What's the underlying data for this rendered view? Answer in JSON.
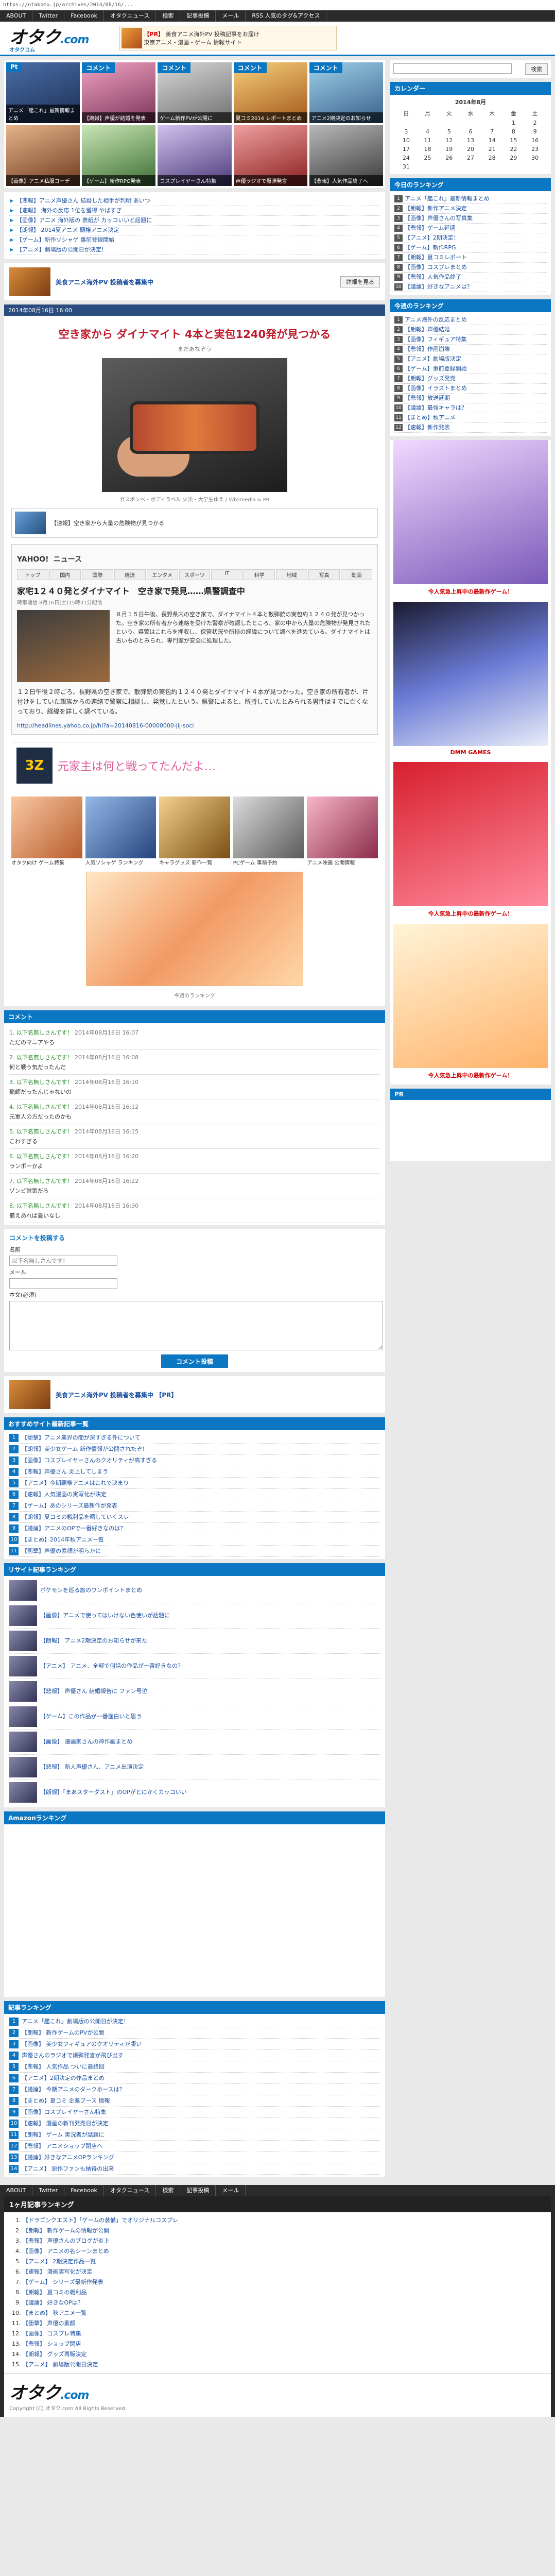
{
  "url": "https://otakomu.jp/archives/2014/08/16/...",
  "nav": [
    "ABOUT",
    "Twitter",
    "Facebook",
    "オタクニュース",
    "検索",
    "記事投稿",
    "メール",
    "RSS 人気のタグ&アクセス"
  ],
  "logo": {
    "name": "オタク",
    "dot": ".com",
    "sub": "オタクコム"
  },
  "header_banner": {
    "label": "【PR】",
    "text": "美食アニメ海外PV 投稿記事をお届け",
    "sub": "東京アニメ・漫画・ゲーム 情報サイト"
  },
  "tiles": [
    {
      "num": "Pt",
      "cap": "アニメ「艦これ」最新情報まとめ"
    },
    {
      "num": "コメント",
      "cap": "【朗報】声優が結婚を発表"
    },
    {
      "num": "コメント",
      "cap": "ゲーム新作PVが公開に"
    },
    {
      "num": "コメント",
      "cap": "夏コミ2014 レポートまとめ"
    },
    {
      "num": "コメント",
      "cap": "アニメ2期決定のお知らせ"
    },
    {
      "num": "",
      "cap": "【画像】アニメ私服コーデ"
    },
    {
      "num": "",
      "cap": "【ゲーム】新作RPG発表"
    },
    {
      "num": "",
      "cap": "コスプレイヤーさん特集"
    },
    {
      "num": "",
      "cap": "声優ラジオで爆弾発言"
    },
    {
      "num": "",
      "cap": "【悲報】人気作品終了へ"
    }
  ],
  "top_links": [
    "【悲報】アニメ声優さん 結婚した相手が判明 あいつ",
    "【速報】 海外の反応 1位を獲得 やばすぎ",
    "【画像】アニメ 海外版の 表紙が カッコいいと話題に",
    "【朗報】 2014夏アニメ 覇権アニメ決定",
    "【ゲーム】新作ソシャゲ 事前登録開始",
    "【アニメ】劇場版の公開日が決定！"
  ],
  "promo": {
    "text": "美食アニメ海外PV 投稿者を募集中",
    "button": "詳細を見る"
  },
  "article": {
    "meta": "2014年08月16日 16:00",
    "title": "空き家から ダイナマイト 4本と実包1240発が見つかる",
    "byline": "まだあなぞう",
    "image_caption": "ガスボンベ・ボディラベル 火災・大学生ゆえ / Wikimedia & PR",
    "related": "【速報】空き家から大量の危険物が見つかる",
    "quote": {
      "logo": "YAHOO!",
      "logo_sub": "ニュース",
      "nav": [
        "トップ",
        "国内",
        "国際",
        "経済",
        "エンタメ",
        "スポーツ",
        "IT",
        "科学",
        "地域",
        "写真",
        "動画"
      ],
      "title": "家宅1２４０発とダイナマイト　空き家で発見……県警調査中",
      "date": "時事通信 8月16日(土)15時31分配信",
      "text": "８月１５日午後、長野県内の空き家で、ダイナマイト４本と散弾銃の実包約１２４０発が見つかった。空き家の所有者から連絡を受けた警察が確認したところ、家の中から大量の危険物が発見されたという。県警はこれらを押収し、保管状況や所持の経緯について調べを進めている。ダイナマイトは古いものとみられ、専門家が安全に処理した。",
      "body": "１２日午後２時ごろ、長野県の空き家で、散弾銃の実包約１２４０発とダイナマイト４本が見つかった。空き家の所有者が、片付けをしていた親族からの連絡で警察に相談し、発覚したという。県警によると、所持していたとみられる男性はすでに亡くなっており、経緯を詳しく調べている。"
    },
    "source": "http://headlines.yahoo.co.jp/hl?a=20140816-00000000-jij-soci",
    "card": {
      "logo": "3Z",
      "text": "元家主は何と戦ってたんだよ…"
    },
    "ads": [
      {
        "cap": "オタク向け ゲーム特集"
      },
      {
        "cap": "人気ソシャゲ ランキング"
      },
      {
        "cap": "キャラグッズ 新作一覧"
      },
      {
        "cap": "PCゲーム 事前予約"
      },
      {
        "cap": "アニメ映画 公開情報"
      }
    ],
    "banner_cap": "今週のランキング"
  },
  "comments": {
    "title": "コメント",
    "items": [
      {
        "name": "1. 以下名無しさんです！",
        "date": "2014年08月16日 16:07",
        "body": "ただのマニアやろ"
      },
      {
        "name": "2. 以下名無しさんです！",
        "date": "2014年08月16日 16:08",
        "body": "何と戦う気だったんだ"
      },
      {
        "name": "3. 以下名無しさんです！",
        "date": "2014年08月16日 16:10",
        "body": "猟師だったんじゃないの"
      },
      {
        "name": "4. 以下名無しさんです！",
        "date": "2014年08月16日 16:12",
        "body": "元軍人の方だったのかも"
      },
      {
        "name": "5. 以下名無しさんです！",
        "date": "2014年08月16日 16:15",
        "body": "こわすぎる"
      },
      {
        "name": "6. 以下名無しさんです！",
        "date": "2014年08月16日 16:20",
        "body": "ランボーかよ"
      },
      {
        "name": "7. 以下名無しさんです！",
        "date": "2014年08月16日 16:22",
        "body": "ゾンビ対策だろ"
      },
      {
        "name": "8. 以下名無しさんです！",
        "date": "2014年08月16日 16:30",
        "body": "備えあれば憂いなし"
      }
    ]
  },
  "comment_form": {
    "title": "コメントを投稿する",
    "name_label": "名前",
    "name_placeholder": "以下名無しさんです！",
    "mail_label": "メール",
    "body_label": "本文(必須)",
    "submit": "コメント投稿"
  },
  "promo2": {
    "text": "美食アニメ海外PV 投稿者を募集中 【PR】"
  },
  "recommend": {
    "title": "おすすめサイト最新記事一覧",
    "items": [
      "【衝撃】アニメ業界の闇が深すぎる件について",
      "【朗報】美少女ゲーム 新作情報が公開されたぞ！",
      "【画像】コスプレイヤーさんのクオリティが高すぎる",
      "【悲報】声優さん 炎上してしまう",
      "【アニメ】今期覇権アニメはこれで決まり",
      "【速報】人気漫画の実写化が決定",
      "【ゲーム】あのシリーズ最新作が発表",
      "【朗報】夏コミの戦利品を晒していくスレ",
      "【議論】アニメのOPで一番好きなのは？",
      "【まとめ】2014年秋アニメ一覧",
      "【衝撃】声優の素顔が明らかに"
    ]
  },
  "ranking": {
    "title": "リサイト記事ランキング",
    "items": [
      "ポケモンを巡る旅のワンポイントまとめ",
      "【画像】アニメで使ってはいけない色使いが話題に",
      "【朗報】 アニメ2期決定のお知らせが来た",
      "【アニメ】 アニメ、全部で何話の作品が一番好きなの？",
      "【悲報】 声優さん 結婚報告に ファン号泣",
      "【ゲーム】この作品が一番面白いと思う",
      "【画像】 漫画家さんの神作画まとめ",
      "【悲報】 新人声優さん、アニメ出演決定",
      "【朗報】「まあスターダスト」のOPがとにかくカッコいい"
    ]
  },
  "amazon_title": "Amazonランキング",
  "recommend2": {
    "title": "記事ランキング",
    "items": [
      "アニメ「艦これ」劇場版の公開日が決定！",
      "【朗報】 新作ゲームのPVが公開",
      "【画像】 美少女フィギュアのクオリティが凄い",
      "声優さんのラジオで爆弾発言が飛び出す",
      "【悲報】 人気作品 ついに最終回",
      "【アニメ】2期決定の作品まとめ",
      "【議論】 今期アニメのダークホースは？",
      "【まとめ】夏コミ 企業ブース 情報",
      "【画像】コスプレイヤーさん特集",
      "【速報】 漫画の新刊発売日が決定",
      "【朗報】 ゲーム 実況者が話題に",
      "【悲報】 アニメショップ閉店へ",
      "【議論】好きなアニメOPランキング",
      "【アニメ】 原作ファンも納得の出来"
    ]
  },
  "side": {
    "search_placeholder": "",
    "search_button": "検索",
    "calendar_title": "カレンダー",
    "month": "2014年8月",
    "weekdays": [
      "日",
      "月",
      "火",
      "水",
      "木",
      "金",
      "土"
    ],
    "weeks": [
      [
        "",
        "",
        "",
        "",
        "",
        "1",
        "2"
      ],
      [
        "3",
        "4",
        "5",
        "6",
        "7",
        "8",
        "9"
      ],
      [
        "10",
        "11",
        "12",
        "13",
        "14",
        "15",
        "16"
      ],
      [
        "17",
        "18",
        "19",
        "20",
        "21",
        "22",
        "23"
      ],
      [
        "24",
        "25",
        "26",
        "27",
        "28",
        "29",
        "30"
      ],
      [
        "31",
        "",
        "",
        "",
        "",
        "",
        ""
      ]
    ],
    "ranking_title": "今日のランキング",
    "ranking": [
      "アニメ「艦これ」最新情報まとめ",
      "【朗報】新作アニメ決定",
      "【画像】声優さんの写真集",
      "【悲報】ゲーム延期",
      "【アニメ】2期決定！",
      "【ゲーム】新作RPG",
      "【朗報】夏コミレポート",
      "【画像】コスプレまとめ",
      "【悲報】人気作品終了",
      "【議論】好きなアニメは？"
    ],
    "ranking2_title": "今週のランキング",
    "ranking2": [
      "アニメ海外の反応まとめ",
      "【朗報】声優結婚",
      "【画像】フィギュア特集",
      "【悲報】作画崩壊",
      "【アニメ】劇場版決定",
      "【ゲーム】事前登録開始",
      "【朗報】グッズ発売",
      "【画像】イラストまとめ",
      "【悲報】放送延期",
      "【議論】最強キャラは？",
      "【まとめ】秋アニメ",
      "【速報】新作発表"
    ],
    "ad_captions": [
      "今人気急上昇中の最新作ゲーム！",
      "DMM GAMES",
      "今人気急上昇中の最新作ゲーム！",
      "今人気急上昇中の最新作ゲーム！"
    ],
    "pr_title": "PR"
  },
  "footer": {
    "rank_title": "1ヶ月記事ランキング",
    "items": [
      "【ドラゴンクエスト】「ゲームの装備」でオリジナルコスプレ",
      "【朗報】 新作ゲームの情報が公開",
      "【悲報】 声優さんのブログが炎上",
      "【画像】 アニメの名シーンまとめ",
      "【アニメ】 2期決定作品一覧",
      "【速報】 漫画実写化が決定",
      "【ゲーム】 シリーズ最新作発表",
      "【朗報】 夏コミの戦利品",
      "【議論】 好きなOPは？",
      "【まとめ】 秋アニメ一覧",
      "【衝撃】 声優の素顔",
      "【画像】 コスプレ特集",
      "【悲報】 ショップ閉店",
      "【朗報】 グッズ再販決定",
      "【アニメ】 劇場版公開日決定"
    ],
    "copyright": "Copyright (C) オタク.com All Rights Reserved."
  }
}
